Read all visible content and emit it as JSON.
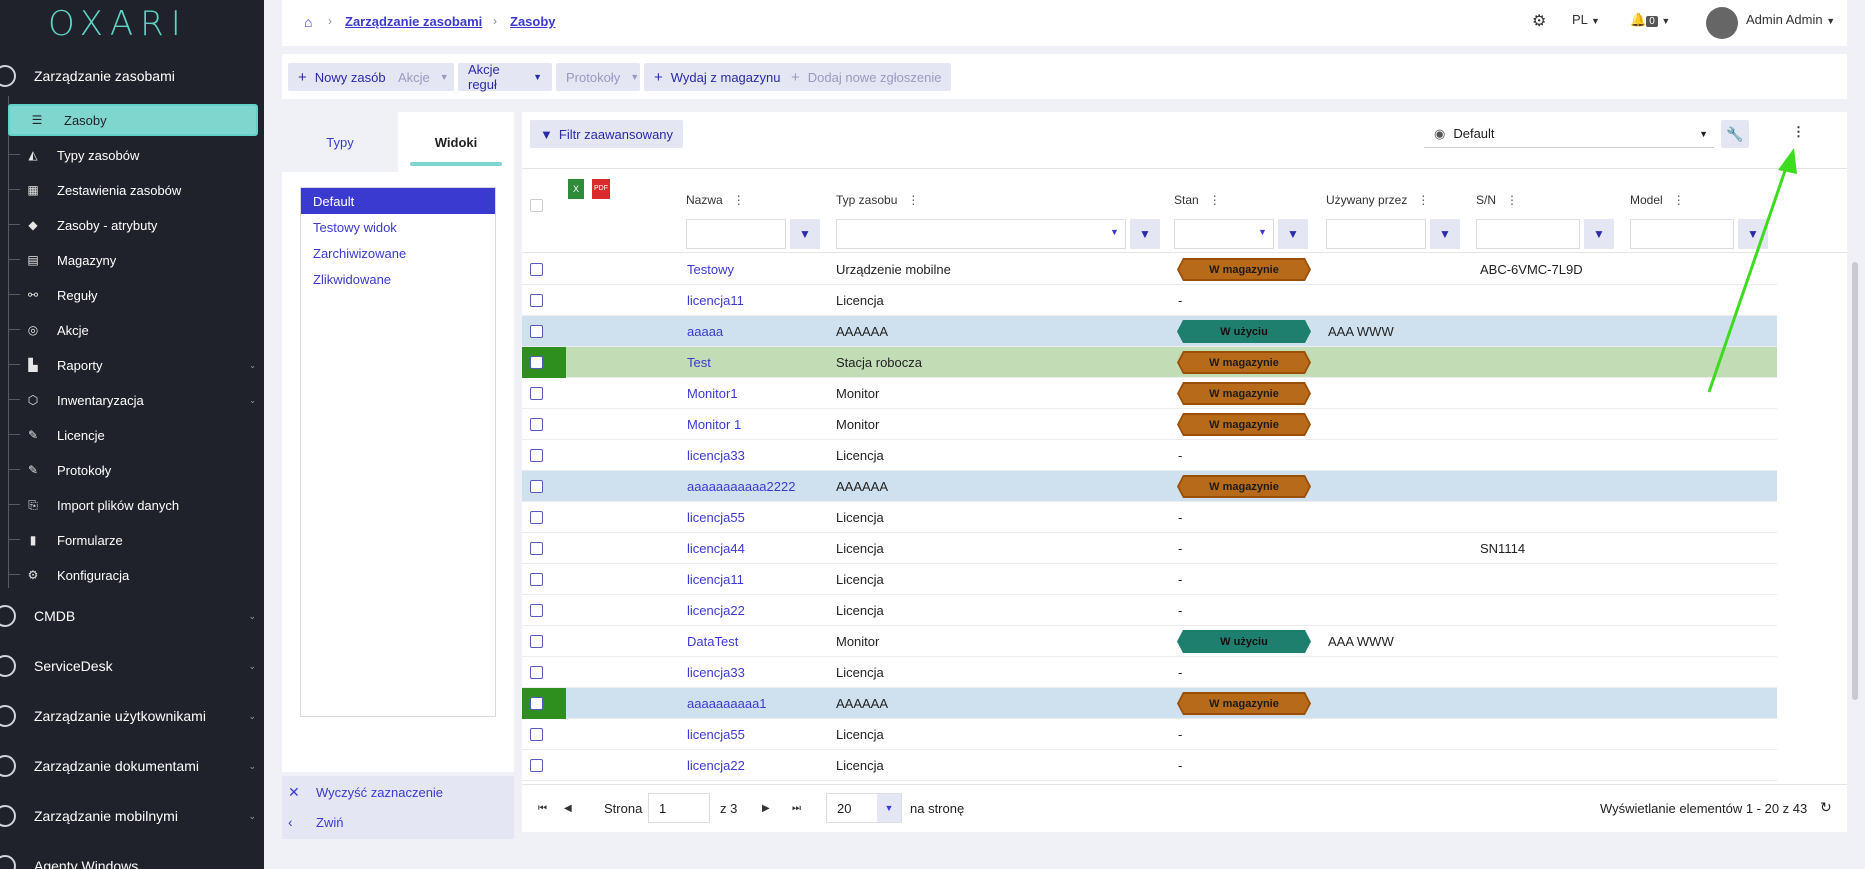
{
  "logo": "OXARI",
  "sidebar": {
    "sections_top": [
      {
        "label": "Zarządzanie zasobami"
      }
    ],
    "items": [
      {
        "label": "Zasoby",
        "icon": "list-icon"
      },
      {
        "label": "Typy zasobów",
        "icon": "shapes-icon"
      },
      {
        "label": "Zestawienia zasobów",
        "icon": "table-icon"
      },
      {
        "label": "Zasoby - atrybuty",
        "icon": "tag-icon"
      },
      {
        "label": "Magazyny",
        "icon": "warehouse-icon"
      },
      {
        "label": "Reguły",
        "icon": "flow-icon"
      },
      {
        "label": "Akcje",
        "icon": "target-icon"
      },
      {
        "label": "Raporty",
        "icon": "chart-icon"
      },
      {
        "label": "Inwentaryzacja",
        "icon": "box-icon"
      },
      {
        "label": "Licencje",
        "icon": "license-icon"
      },
      {
        "label": "Protokoły",
        "icon": "protocol-icon"
      },
      {
        "label": "Import plików danych",
        "icon": "import-icon"
      },
      {
        "label": "Formularze",
        "icon": "form-icon"
      },
      {
        "label": "Konfiguracja",
        "icon": "cogs-icon"
      }
    ],
    "sections": [
      {
        "label": "CMDB"
      },
      {
        "label": "ServiceDesk"
      },
      {
        "label": "Zarządzanie użytkownikami"
      },
      {
        "label": "Zarządzanie dokumentami"
      },
      {
        "label": "Zarządzanie mobilnymi"
      },
      {
        "label": "Agenty Windows"
      }
    ]
  },
  "breadcrumb": {
    "level1": "Zarządzanie zasobami",
    "level2": "Zasoby"
  },
  "topbar": {
    "lang": "PL",
    "notifications": "0",
    "user": "Admin Admin"
  },
  "toolbar": {
    "new": "Nowy zasób",
    "actions": "Akcje",
    "rule_actions": "Akcje reguł",
    "protocols": "Protokoły",
    "issue": "Wydaj z magazynu",
    "add_ticket": "Dodaj nowe zgłoszenie"
  },
  "leftpanel": {
    "tab1": "Typy",
    "tab2": "Widoki",
    "views": [
      "Default",
      "Testowy widok",
      "Zarchiwizowane",
      "Zlikwidowane"
    ],
    "clear": "Wyczyść zaznaczenie",
    "collapse": "Zwiń"
  },
  "main": {
    "filter": "Filtr zaawansowany",
    "view": "Default",
    "columns": {
      "name": "Nazwa",
      "type": "Typ zasobu",
      "state": "Stan",
      "used_by": "Używany przez",
      "sn": "S/N",
      "model": "Model"
    },
    "export_excel": "X",
    "export_pdf": "PDF",
    "rows": [
      {
        "name": "Testowy",
        "type": "Urządzenie mobilne",
        "state": "W magazynie",
        "used_by": "",
        "sn": "ABC-6VMC-7L9D",
        "hl": ""
      },
      {
        "name": "licencja11",
        "type": "Licencja",
        "state": "-",
        "used_by": "",
        "sn": "",
        "hl": ""
      },
      {
        "name": "aaaaa",
        "type": "AAAAAA",
        "state": "W użyciu",
        "used_by": "AAA WWW",
        "sn": "",
        "hl": "blue"
      },
      {
        "name": "Test",
        "type": "Stacja robocza",
        "state": "W magazynie",
        "used_by": "",
        "sn": "",
        "hl": "green"
      },
      {
        "name": "Monitor1",
        "type": "Monitor",
        "state": "W magazynie",
        "used_by": "",
        "sn": "",
        "hl": ""
      },
      {
        "name": "Monitor 1",
        "type": "Monitor",
        "state": "W magazynie",
        "used_by": "",
        "sn": "",
        "hl": ""
      },
      {
        "name": "licencja33",
        "type": "Licencja",
        "state": "-",
        "used_by": "",
        "sn": "",
        "hl": ""
      },
      {
        "name": "aaaaaaaaaaa2222",
        "type": "AAAAAA",
        "state": "W magazynie",
        "used_by": "",
        "sn": "",
        "hl": "blue"
      },
      {
        "name": "licencja55",
        "type": "Licencja",
        "state": "-",
        "used_by": "",
        "sn": "",
        "hl": ""
      },
      {
        "name": "licencja44",
        "type": "Licencja",
        "state": "-",
        "used_by": "",
        "sn": "SN1114",
        "hl": ""
      },
      {
        "name": "licencja11",
        "type": "Licencja",
        "state": "-",
        "used_by": "",
        "sn": "",
        "hl": ""
      },
      {
        "name": "licencja22",
        "type": "Licencja",
        "state": "-",
        "used_by": "",
        "sn": "",
        "hl": ""
      },
      {
        "name": "DataTest",
        "type": "Monitor",
        "state": "W użyciu",
        "used_by": "AAA WWW",
        "sn": "",
        "hl": ""
      },
      {
        "name": "licencja33",
        "type": "Licencja",
        "state": "-",
        "used_by": "",
        "sn": "",
        "hl": ""
      },
      {
        "name": "aaaaaaaaaa1",
        "type": "AAAAAA",
        "state": "W magazynie",
        "used_by": "",
        "sn": "",
        "hl": "blue-mark"
      },
      {
        "name": "licencja55",
        "type": "Licencja",
        "state": "-",
        "used_by": "",
        "sn": "",
        "hl": ""
      },
      {
        "name": "licencja22",
        "type": "Licencja",
        "state": "-",
        "used_by": "",
        "sn": "",
        "hl": ""
      }
    ],
    "pager": {
      "page_label": "Strona",
      "page": "1",
      "of": "z 3",
      "per_page": "20",
      "per_page_label": "na stronę",
      "summary": "Wyświetlanie elementów 1 - 20 z 43"
    }
  },
  "colors": {
    "accent": "#3b3ad0",
    "sidebar_bg": "#1f222a",
    "active_item": "#7ed6cf",
    "in_stock": "#b66a1a",
    "in_use": "#1f7f6e",
    "arrow": "#3ddc1f"
  }
}
